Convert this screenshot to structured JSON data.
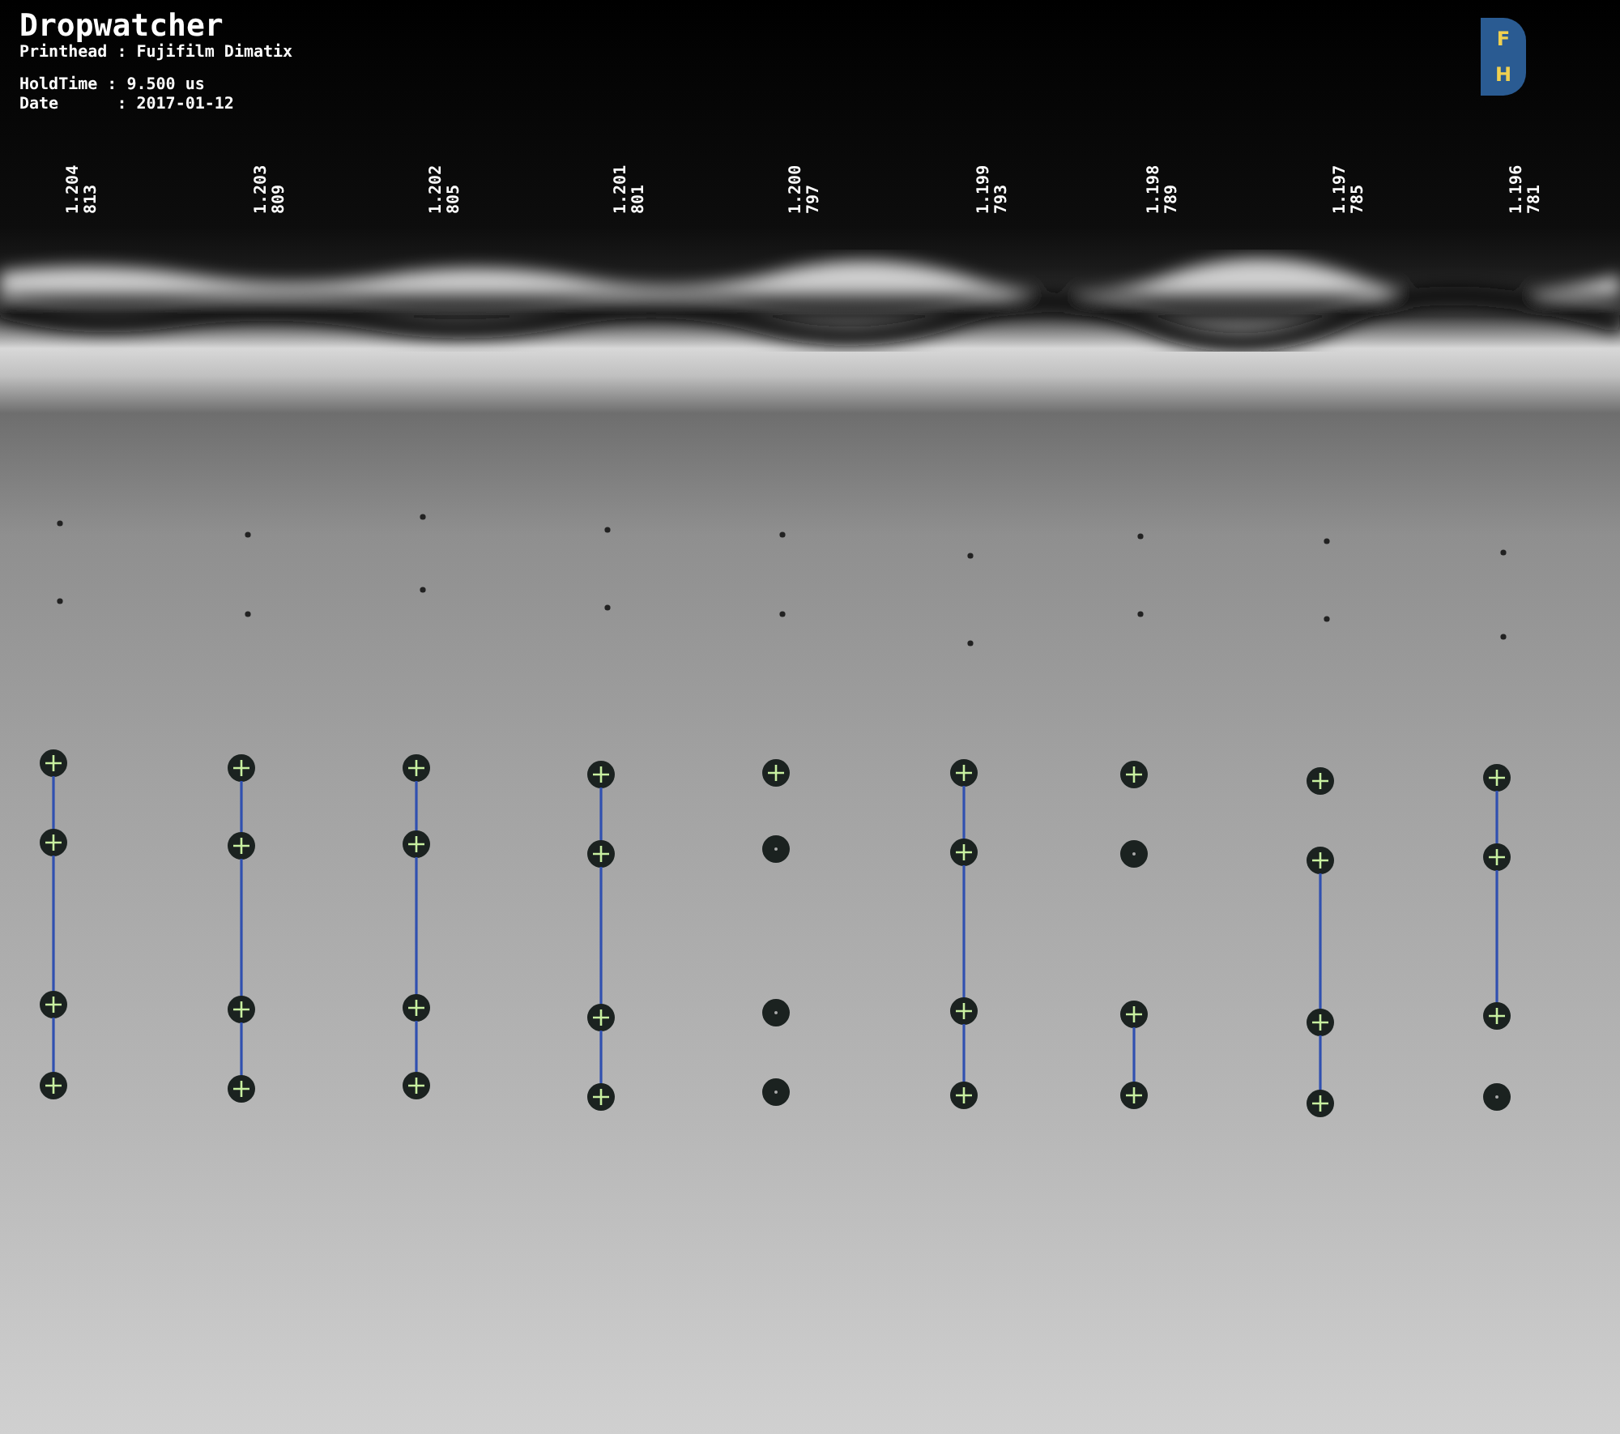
{
  "header": {
    "title": "Dropwatcher",
    "printhead": "Printhead : Fujifilm Dimatix",
    "hold_time": "HoldTime : 9.500 us",
    "date": "Date      : 2017-01-12"
  },
  "logo": {
    "letters": [
      "F",
      "H"
    ]
  },
  "nozzles": [
    {
      "voltage": "1.204",
      "count": "813",
      "drops": [
        {
          "tracked": true,
          "linked": false
        },
        {
          "tracked": true,
          "linked": true
        },
        {
          "tracked": true,
          "linked": true
        },
        {
          "tracked": true,
          "linked": true
        }
      ]
    },
    {
      "voltage": "1.203",
      "count": "809",
      "drops": [
        {
          "tracked": true,
          "linked": false
        },
        {
          "tracked": true,
          "linked": true
        },
        {
          "tracked": true,
          "linked": true
        },
        {
          "tracked": true,
          "linked": true
        }
      ]
    },
    {
      "voltage": "1.202",
      "count": "805",
      "drops": [
        {
          "tracked": true,
          "linked": false
        },
        {
          "tracked": true,
          "linked": true
        },
        {
          "tracked": true,
          "linked": true
        },
        {
          "tracked": true,
          "linked": true
        }
      ]
    },
    {
      "voltage": "1.201",
      "count": "801",
      "drops": [
        {
          "tracked": true,
          "linked": false
        },
        {
          "tracked": true,
          "linked": true
        },
        {
          "tracked": true,
          "linked": true
        },
        {
          "tracked": true,
          "linked": true
        }
      ]
    },
    {
      "voltage": "1.200",
      "count": "797",
      "drops": [
        {
          "tracked": true,
          "linked": false
        },
        {
          "tracked": false,
          "linked": false
        },
        {
          "tracked": false,
          "linked": false
        },
        {
          "tracked": false,
          "linked": false
        }
      ]
    },
    {
      "voltage": "1.199",
      "count": "793",
      "drops": [
        {
          "tracked": true,
          "linked": false
        },
        {
          "tracked": true,
          "linked": true
        },
        {
          "tracked": true,
          "linked": true
        },
        {
          "tracked": true,
          "linked": true
        }
      ]
    },
    {
      "voltage": "1.198",
      "count": "789",
      "drops": [
        {
          "tracked": true,
          "linked": false
        },
        {
          "tracked": false,
          "linked": false
        },
        {
          "tracked": true,
          "linked": false
        },
        {
          "tracked": true,
          "linked": true
        }
      ]
    },
    {
      "voltage": "1.197",
      "count": "785",
      "drops": [
        {
          "tracked": true,
          "linked": false
        },
        {
          "tracked": true,
          "linked": false
        },
        {
          "tracked": true,
          "linked": true
        },
        {
          "tracked": true,
          "linked": true
        }
      ]
    },
    {
      "voltage": "1.196",
      "count": "781",
      "drops": [
        {
          "tracked": true,
          "linked": false
        },
        {
          "tracked": true,
          "linked": true
        },
        {
          "tracked": true,
          "linked": true
        },
        {
          "tracked": false,
          "linked": false
        }
      ]
    }
  ]
}
